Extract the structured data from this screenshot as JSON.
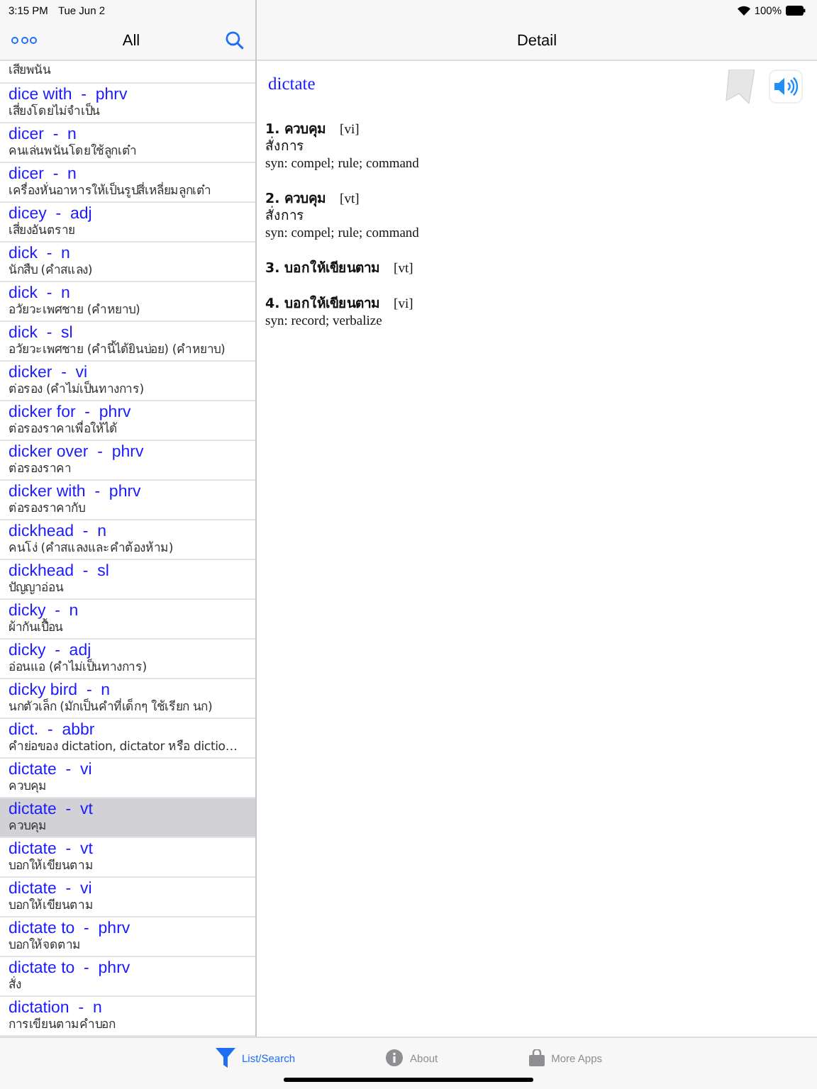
{
  "status_bar": {
    "time": "3:15 PM",
    "date": "Tue Jun 2",
    "battery_text": "100%"
  },
  "list_nav": {
    "title": "All"
  },
  "entries": [
    {
      "meaning": "เสียพนัน",
      "selected": false
    },
    {
      "headline": "dice with  -  phrv",
      "meaning": "เสี่ยงโดยไม่จำเป็น",
      "selected": false
    },
    {
      "headline": "dicer  -  n",
      "meaning": "คนเล่นพนันโดยใช้ลูกเต๋า",
      "selected": false
    },
    {
      "headline": "dicer  -  n",
      "meaning": "เครื่องหั่นอาหารให้เป็นรูปสี่เหลี่ยมลูกเต๋า",
      "selected": false
    },
    {
      "headline": "dicey  -  adj",
      "meaning": "เสี่ยงอันตราย",
      "selected": false
    },
    {
      "headline": "dick  -  n",
      "meaning": "นักสืบ (คำสแลง)",
      "selected": false
    },
    {
      "headline": "dick  -  n",
      "meaning": "อวัยวะเพศชาย (คำหยาบ)",
      "selected": false
    },
    {
      "headline": "dick  -  sl",
      "meaning": "อวัยวะเพศชาย (คำนี้ได้ยินบ่อย) (คำหยาบ)",
      "selected": false
    },
    {
      "headline": "dicker  -  vi",
      "meaning": "ต่อรอง (คำไม่เป็นทางการ)",
      "selected": false
    },
    {
      "headline": "dicker for  -  phrv",
      "meaning": "ต่อรองราคาเพื่อให้ได้",
      "selected": false
    },
    {
      "headline": "dicker over  -  phrv",
      "meaning": "ต่อรองราคา",
      "selected": false
    },
    {
      "headline": "dicker with  -  phrv",
      "meaning": "ต่อรองราคากับ",
      "selected": false
    },
    {
      "headline": "dickhead  -  n",
      "meaning": "คนโง่ (คำสแลงและคำต้องห้าม)",
      "selected": false
    },
    {
      "headline": "dickhead  -  sl",
      "meaning": "ปัญญาอ่อน",
      "selected": false
    },
    {
      "headline": "dicky  -  n",
      "meaning": "ผ้ากันเปื้อน",
      "selected": false
    },
    {
      "headline": "dicky  -  adj",
      "meaning": "อ่อนแอ (คำไม่เป็นทางการ)",
      "selected": false
    },
    {
      "headline": "dicky bird  -  n",
      "meaning": "นกตัวเล็ก (มักเป็นคำที่เด็กๆ ใช้เรียก นก)",
      "selected": false
    },
    {
      "headline": "dict.  -  abbr",
      "meaning": "คำย่อของ dictation, dictator หรือ dictio…",
      "selected": false
    },
    {
      "headline": "dictate  -  vi",
      "meaning": "ควบคุม",
      "selected": false
    },
    {
      "headline": "dictate  -  vt",
      "meaning": "ควบคุม",
      "selected": true
    },
    {
      "headline": "dictate  -  vt",
      "meaning": "บอกให้เขียนตาม",
      "selected": false
    },
    {
      "headline": "dictate  -  vi",
      "meaning": "บอกให้เขียนตาม",
      "selected": false
    },
    {
      "headline": "dictate to  -  phrv",
      "meaning": "บอกให้จดตาม",
      "selected": false
    },
    {
      "headline": "dictate to  -  phrv",
      "meaning": "สั่ง",
      "selected": false
    },
    {
      "headline": "dictation  -  n",
      "meaning": "การเขียนตามคำบอก",
      "selected": false
    }
  ],
  "detail_nav": {
    "title": "Detail"
  },
  "detail": {
    "headword": "dictate",
    "senses": [
      {
        "title": "1. ควบคุม",
        "pos": "[vi]",
        "lines": [
          "สั่งการ",
          "syn: compel; rule; command"
        ]
      },
      {
        "title": "2. ควบคุม",
        "pos": "[vt]",
        "lines": [
          "สั่งการ",
          "syn: compel; rule; command"
        ]
      },
      {
        "title": "3. บอกให้เขียนตาม",
        "pos": "[vt]"
      },
      {
        "title": "4. บอกให้เขียนตาม",
        "pos": "[vi]",
        "lines": [
          "syn: record; verbalize"
        ]
      }
    ]
  },
  "tab_bar": [
    {
      "label": "List/Search",
      "kind": "filter",
      "selected": true
    },
    {
      "label": "About",
      "kind": "info",
      "selected": false
    },
    {
      "label": "More Apps",
      "kind": "bag",
      "selected": false
    }
  ]
}
